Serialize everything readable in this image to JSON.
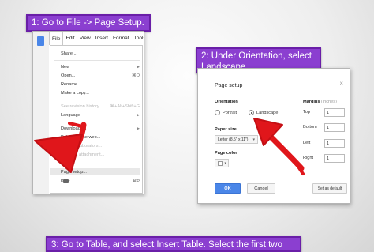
{
  "callouts": {
    "step1": "1: Go to File -> Page Setup.",
    "step2": "2: Under Orientation, select Landscape.",
    "step3": "3: Go to Table, and select Insert Table.  Select the first two"
  },
  "menubar": [
    "File",
    "Edit",
    "View",
    "Insert",
    "Format",
    "Tools"
  ],
  "file_menu": {
    "share": "Share...",
    "new": "New",
    "open": "Open...",
    "open_shortcut": "⌘O",
    "rename": "Rename...",
    "make_copy": "Make a copy...",
    "revision_history": "See revision history",
    "revision_shortcut": "⌘+Alt+Shift+G",
    "language": "Language",
    "download_as": "Download as",
    "publish": "Publish to the web...",
    "email_collaborators": "Email collaborators...",
    "email_attachment": "Email as attachment...",
    "page_setup": "Page setup...",
    "print": "Print",
    "print_shortcut": "⌘P"
  },
  "dialog": {
    "title": "Page setup",
    "close": "×",
    "orientation_label": "Orientation",
    "portrait": "Portrait",
    "landscape": "Landscape",
    "paper_size_label": "Paper size",
    "paper_size_value": "Letter (8.5\" x 11\")",
    "page_color_label": "Page color",
    "margins_label": "Margins",
    "margins_unit": "(inches)",
    "margins": [
      {
        "label": "Top",
        "value": "1"
      },
      {
        "label": "Bottom",
        "value": "1"
      },
      {
        "label": "Left",
        "value": "1"
      },
      {
        "label": "Right",
        "value": "1"
      }
    ],
    "ok": "OK",
    "cancel": "Cancel",
    "set_default": "Set as default"
  },
  "colors": {
    "callout": "#8b3fd0",
    "arrow": "#e0161b",
    "ok_button": "#4a86e8"
  }
}
